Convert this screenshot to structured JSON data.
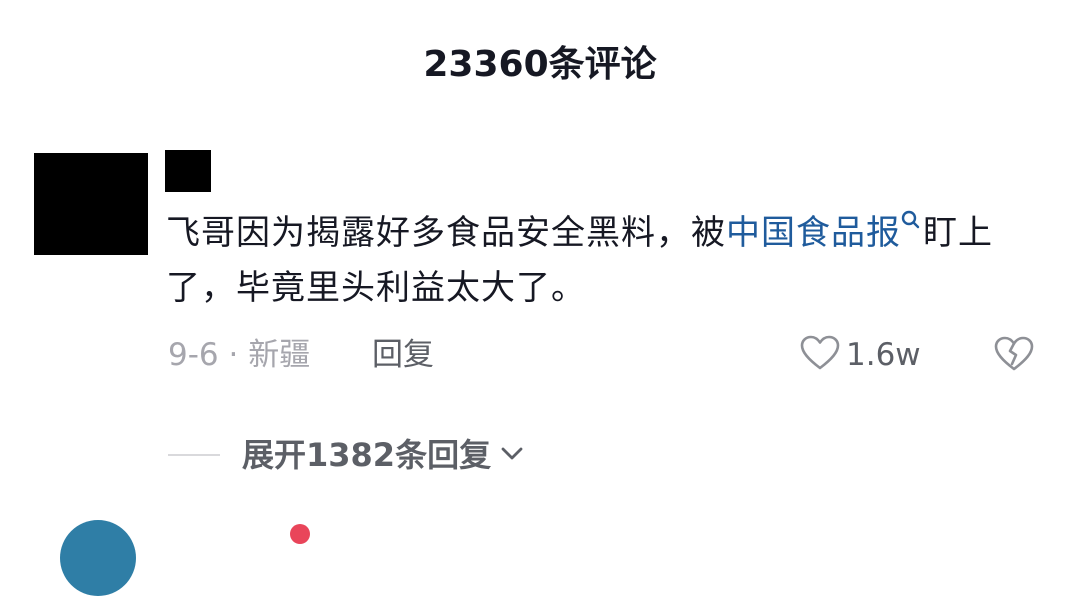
{
  "header": {
    "comment_count_title": "23360条评论"
  },
  "comment": {
    "text_before": "飞哥因为揭露好多食品安全黑料，被",
    "mention": "中国食品报",
    "text_after": "盯上了，毕竟里头利益太大了。",
    "date_location": "9-6 · 新疆",
    "reply_label": "回复",
    "like_count": "1.6w",
    "expand_replies_label": "展开1382条回复"
  },
  "icons": {
    "search": "search-icon",
    "like": "heart-outline-icon",
    "dislike": "broken-heart-icon",
    "expand": "chevron-down-icon"
  },
  "colors": {
    "text_primary": "#161823",
    "text_secondary": "#5c5f66",
    "text_muted": "#a6a6ad",
    "mention_link": "#1f5b9c",
    "redaction": "#000000"
  }
}
